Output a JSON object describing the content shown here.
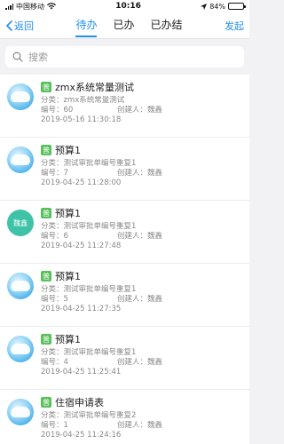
{
  "status": {
    "carrier": "中国移动",
    "time": "10:16",
    "battery": "84%",
    "battery_level": 0.84
  },
  "nav": {
    "back_label": "返回",
    "tabs": [
      "待办",
      "已办",
      "已办结"
    ],
    "active_tab": 0,
    "launch_label": "发起"
  },
  "search": {
    "placeholder": "搜索"
  },
  "items": [
    {
      "badge": "普",
      "title": "zmx系统常量测试",
      "category": "分类：zmx系统常量测试",
      "number": "编号：60",
      "creator": "创建人：魏鑫",
      "time": "2019-05-16 11:30:18",
      "avatar": "image"
    },
    {
      "badge": "普",
      "title": "预算1",
      "category": "分类：测试审批单编号重复1",
      "number": "编号：7",
      "creator": "创建人：魏鑫",
      "time": "2019-04-25 11:28:00",
      "avatar": "image"
    },
    {
      "badge": "普",
      "title": "预算1",
      "category": "分类：测试审批单编号重复1",
      "number": "编号：6",
      "creator": "创建人：魏鑫",
      "time": "2019-04-25 11:27:48",
      "avatar": "text",
      "avatar_text": "魏鑫"
    },
    {
      "badge": "普",
      "title": "预算1",
      "category": "分类：测试审批单编号重复1",
      "number": "编号：5",
      "creator": "创建人：魏鑫",
      "time": "2019-04-25 11:27:35",
      "avatar": "image"
    },
    {
      "badge": "普",
      "title": "预算1",
      "category": "分类：测试审批单编号重复1",
      "number": "编号：4",
      "creator": "创建人：魏鑫",
      "time": "2019-04-25 11:25:41",
      "avatar": "image"
    },
    {
      "badge": "普",
      "title": "住宿申请表",
      "category": "分类：测试审批单编号重复2",
      "number": "编号：1",
      "creator": "创建人：魏鑫",
      "time": "2019-04-25 11:24:16",
      "avatar": "image"
    }
  ]
}
